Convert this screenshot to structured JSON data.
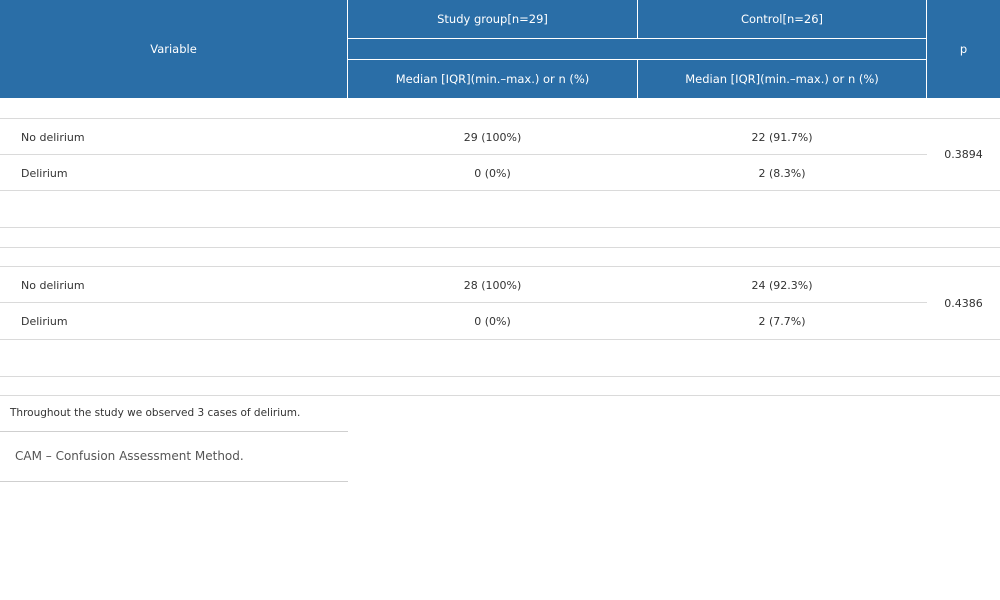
{
  "header": {
    "variable": "Variable",
    "study_group": "Study group[n=29]",
    "control": "Control[n=26]",
    "p": "p",
    "study_sub": "Median [IQR](min.–max.) or n (%)",
    "control_sub": "Median [IQR](min.–max.) or n (%)"
  },
  "sections": [
    {
      "rows": [
        {
          "label": "No delirium",
          "study": "29 (100%)",
          "control": "22 (91.7%)"
        },
        {
          "label": "Delirium",
          "study": "0 (0%)",
          "control": "2 (8.3%)"
        }
      ],
      "p": "0.3894"
    },
    {
      "rows": [
        {
          "label": "No delirium",
          "study": "28 (100%)",
          "control": "24 (92.3%)"
        },
        {
          "label": "Delirium",
          "study": "0 (0%)",
          "control": "2 (7.7%)"
        }
      ],
      "p": "0.4386"
    }
  ],
  "note": "Throughout the study we observed 3 cases of delirium.",
  "footnote": "CAM – Confusion Assessment Method."
}
